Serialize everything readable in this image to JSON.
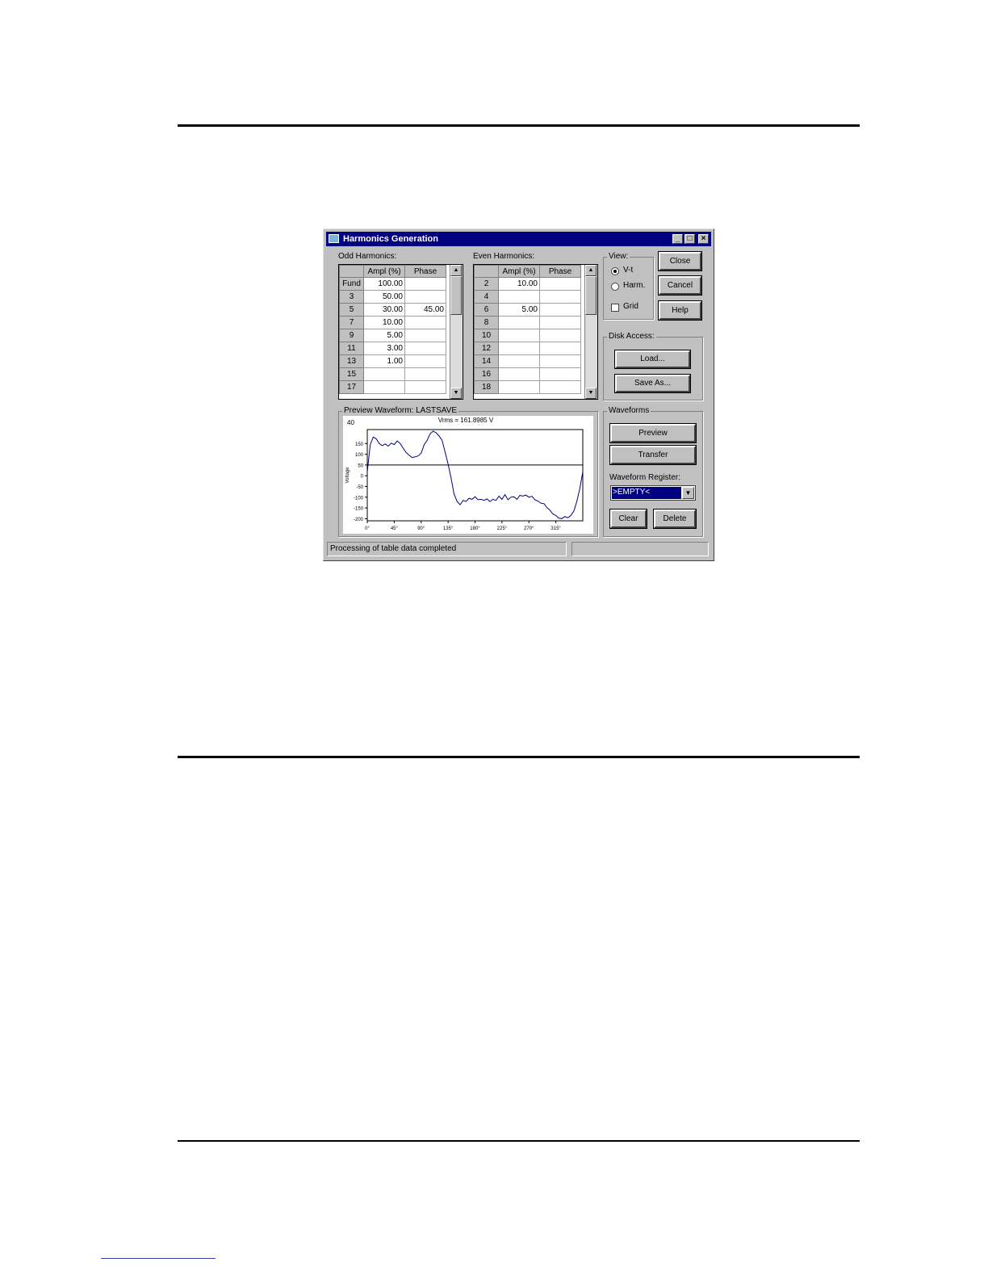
{
  "window": {
    "title": "Harmonics Generation",
    "minimize_label": "_",
    "maximize_label": "□",
    "close_label": "×"
  },
  "odd": {
    "label": "Odd Harmonics:",
    "headers": [
      "",
      "Ampl (%)",
      "Phase"
    ],
    "rows": [
      [
        "Fund",
        "100.00",
        ""
      ],
      [
        "3",
        "50.00",
        ""
      ],
      [
        "5",
        "30.00",
        "45.00"
      ],
      [
        "7",
        "10.00",
        ""
      ],
      [
        "9",
        "5.00",
        ""
      ],
      [
        "11",
        "3.00",
        ""
      ],
      [
        "13",
        "1.00",
        ""
      ],
      [
        "15",
        "",
        ""
      ],
      [
        "17",
        "",
        ""
      ]
    ]
  },
  "even": {
    "label": "Even Harmonics:",
    "headers": [
      "",
      "Ampl (%)",
      "Phase"
    ],
    "rows": [
      [
        "2",
        "10.00",
        ""
      ],
      [
        "4",
        "",
        ""
      ],
      [
        "6",
        "5.00",
        ""
      ],
      [
        "8",
        "",
        ""
      ],
      [
        "10",
        "",
        ""
      ],
      [
        "12",
        "",
        ""
      ],
      [
        "14",
        "",
        ""
      ],
      [
        "16",
        "",
        ""
      ],
      [
        "18",
        "",
        ""
      ]
    ]
  },
  "view": {
    "label": "View:",
    "vt_label": "V-t",
    "harm_label": "Harm.",
    "grid_label": "Grid",
    "selected": "V-t",
    "grid_checked": false
  },
  "buttons": {
    "close": "Close",
    "cancel": "Cancel",
    "help": "Help",
    "load": "Load...",
    "save_as": "Save As...",
    "preview": "Preview",
    "transfer": "Transfer",
    "clear": "Clear",
    "delete": "Delete"
  },
  "disk": {
    "label": "Disk Access:"
  },
  "waveforms": {
    "label": "Waveforms",
    "register_label": "Waveform Register:",
    "register_value": ">EMPTY<"
  },
  "preview": {
    "label": "Preview Waveform: LASTSAVE",
    "corner_value": "40",
    "rms_text": "Vrms = 161.8985 V"
  },
  "chart_data": {
    "type": "line",
    "title": "Vrms = 161.8985 V",
    "ylabel": "Voltage",
    "xlabel": "",
    "x_ticks": [
      "0°",
      "45°",
      "90°",
      "135°",
      "180°",
      "225°",
      "270°",
      "315°"
    ],
    "y_ticks": [
      150,
      100,
      50,
      0,
      -50,
      -100,
      -150,
      -200
    ],
    "xlim": [
      0,
      360
    ],
    "ylim": [
      -210,
      215
    ],
    "series": [
      {
        "color": "#000080",
        "x": [
          0,
          5,
          10,
          15,
          20,
          25,
          30,
          35,
          40,
          45,
          50,
          55,
          60,
          65,
          70,
          75,
          80,
          85,
          90,
          95,
          100,
          105,
          110,
          115,
          120,
          125,
          130,
          135,
          140,
          145,
          150,
          155,
          160,
          165,
          170,
          175,
          180,
          185,
          190,
          195,
          200,
          205,
          210,
          215,
          220,
          225,
          230,
          235,
          240,
          245,
          250,
          255,
          260,
          265,
          270,
          275,
          280,
          285,
          290,
          295,
          300,
          305,
          310,
          315,
          320,
          325,
          330,
          335,
          340,
          345,
          350,
          355,
          360
        ],
        "y": [
          18,
          145,
          180,
          172,
          150,
          140,
          148,
          138,
          152,
          145,
          162,
          150,
          128,
          108,
          95,
          85,
          88,
          92,
          105,
          145,
          165,
          195,
          208,
          200,
          185,
          165,
          110,
          55,
          -10,
          -85,
          -120,
          -135,
          -115,
          -120,
          -105,
          -110,
          -98,
          -112,
          -110,
          -115,
          -108,
          -120,
          -110,
          -115,
          -95,
          -110,
          -88,
          -112,
          -100,
          -98,
          -110,
          -92,
          -95,
          -90,
          -100,
          -96,
          -112,
          -118,
          -128,
          -130,
          -148,
          -160,
          -178,
          -185,
          -198,
          -200,
          -190,
          -196,
          -185,
          -165,
          -120,
          -60,
          18
        ]
      }
    ],
    "horizontal_line": 50,
    "grid": false
  },
  "statusbar": {
    "text": "Processing of table data completed",
    "secondary": ""
  }
}
